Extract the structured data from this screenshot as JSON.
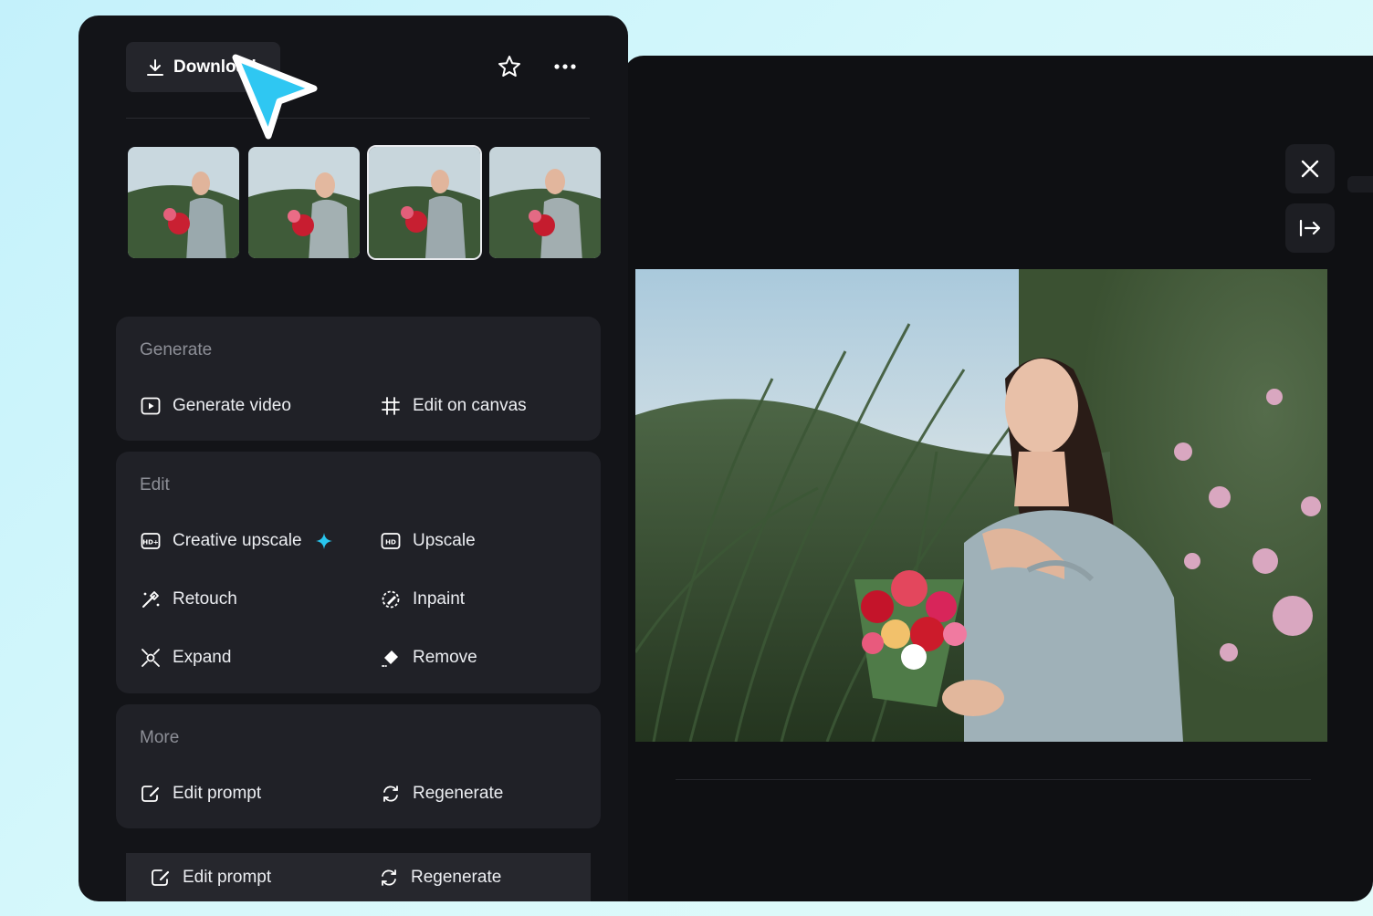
{
  "toolbar": {
    "download_label": "Download",
    "download_icon": "download-icon",
    "favorite_icon": "star-icon",
    "more_icon": "more-horizontal-icon"
  },
  "thumbnails": {
    "count": 4,
    "selected_index": 2
  },
  "generate_section": {
    "title": "Generate",
    "items": [
      {
        "label": "Generate video",
        "icon": "video-play-icon"
      },
      {
        "label": "Edit on canvas",
        "icon": "canvas-grid-icon"
      }
    ]
  },
  "edit_section": {
    "title": "Edit",
    "items": [
      {
        "label": "Creative upscale",
        "icon": "hd-plus-icon",
        "badge_icon": "sparkle-icon"
      },
      {
        "label": "Upscale",
        "icon": "hd-icon"
      },
      {
        "label": "Retouch",
        "icon": "magic-wand-icon"
      },
      {
        "label": "Inpaint",
        "icon": "inpaint-brush-icon"
      },
      {
        "label": "Expand",
        "icon": "expand-icon"
      },
      {
        "label": "Remove",
        "icon": "eraser-icon"
      }
    ]
  },
  "more_section": {
    "title": "More",
    "items": [
      {
        "label": "Edit prompt",
        "icon": "edit-prompt-icon"
      },
      {
        "label": "Regenerate",
        "icon": "regenerate-icon"
      }
    ]
  },
  "bottom_bar": {
    "items": [
      {
        "label": "Edit prompt",
        "icon": "edit-prompt-icon"
      },
      {
        "label": "Regenerate",
        "icon": "regenerate-icon"
      }
    ]
  },
  "viewer": {
    "close_icon": "close-icon",
    "collapse_icon": "collapse-panel-icon"
  },
  "colors": {
    "accent": "#29c6ef",
    "panel_bg": "#131418",
    "card_bg": "#202127",
    "viewer_bg": "#0f1013"
  }
}
